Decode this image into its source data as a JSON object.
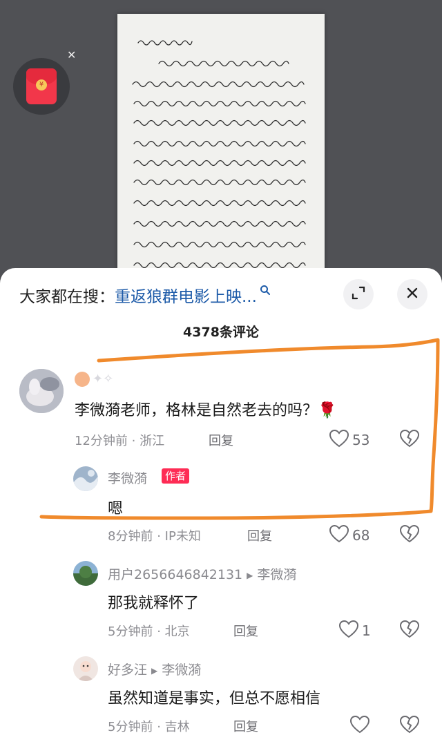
{
  "search": {
    "prefix": "大家都在搜：",
    "term": "重返狼群电影上映..."
  },
  "comment_count": "4378条评论",
  "comments": [
    {
      "text": "李微漪老师，格林是自然老去的吗？🌹",
      "time": "12分钟前",
      "location": "浙江",
      "reply_label": "回复",
      "likes": "53",
      "replies": [
        {
          "name": "李微漪",
          "badge": "作者",
          "text": "嗯",
          "time": "8分钟前",
          "location": "IP未知",
          "reply_label": "回复",
          "likes": "68"
        },
        {
          "name": "用户2656646842131",
          "reply_to": "李微漪",
          "text": "那我就释怀了",
          "time": "5分钟前",
          "location": "北京",
          "reply_label": "回复",
          "likes": "1"
        },
        {
          "name": "好多汪",
          "reply_to": "李微漪",
          "text": "虽然知道是事实，但总不愿相信",
          "time": "5分钟前",
          "location": "吉林",
          "reply_label": "回复",
          "likes": ""
        }
      ]
    }
  ],
  "separator": "·",
  "icons": {
    "redpacket": "red-packet-icon",
    "close": "close-icon",
    "expand": "expand-icon",
    "search": "search-icon",
    "like": "heart-icon",
    "dislike": "broken-heart-icon"
  },
  "colors": {
    "highlight": "#f08a2c",
    "link": "#1c5aa8",
    "badge": "#fe2c55"
  }
}
